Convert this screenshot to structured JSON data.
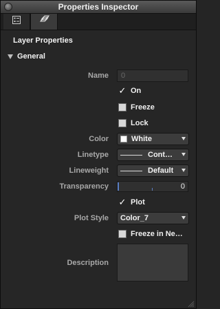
{
  "window": {
    "title": "Properties Inspector"
  },
  "tabs": [
    {
      "icon": "properties-list-icon",
      "selected": false
    },
    {
      "icon": "layers-icon",
      "selected": true
    }
  ],
  "section_title": "Layer Properties",
  "group": {
    "label": "General",
    "expanded": true
  },
  "fields": {
    "name": {
      "label": "Name",
      "value": "0"
    },
    "on": {
      "label": "On",
      "checked": true
    },
    "freeze": {
      "label": "Freeze",
      "checked": false
    },
    "lock": {
      "label": "Lock",
      "checked": false
    },
    "color": {
      "label": "Color",
      "value": "White",
      "swatch": "#ffffff"
    },
    "linetype": {
      "label": "Linetype",
      "value": "Cont…"
    },
    "lineweight": {
      "label": "Lineweight",
      "value": "Default"
    },
    "transparency": {
      "label": "Transparency",
      "value": "0"
    },
    "plot": {
      "label": "Plot",
      "checked": true
    },
    "plot_style": {
      "label": "Plot Style",
      "value": "Color_7"
    },
    "freeze_new": {
      "label": "Freeze in Ne…",
      "checked": false
    },
    "description": {
      "label": "Description",
      "value": ""
    }
  },
  "colors": {
    "background": "#262626",
    "accent": "#5a7fc4",
    "label": "#a8a8a8"
  }
}
